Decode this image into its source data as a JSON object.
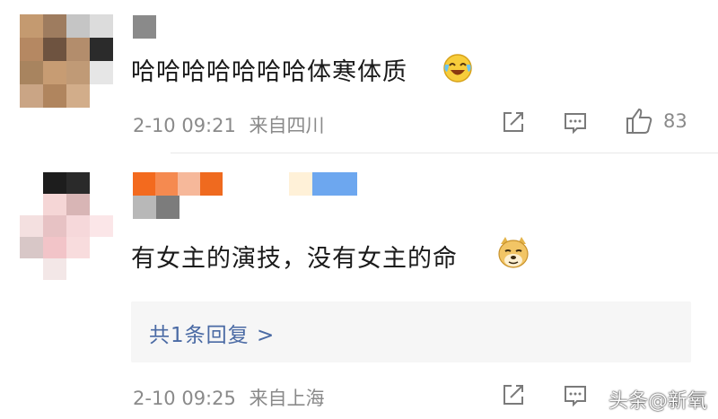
{
  "comments": [
    {
      "text": "哈哈哈哈哈哈哈体寒体质",
      "emoji": "laughing-crying-emoji",
      "time": "2-10 09:21",
      "location": "来自四川",
      "likes": "83"
    },
    {
      "text": "有女主的演技，没有女主的命",
      "emoji": "doge-emoji",
      "time": "2-10 09:25",
      "location": "来自上海",
      "likes": "",
      "reply_link": "共1条回复 >"
    }
  ],
  "watermark": "头条@新氧",
  "colors": {
    "meta_gray": "#8a8a8a",
    "link_blue": "#4a6aa4",
    "reply_bg": "#f6f6f6"
  }
}
